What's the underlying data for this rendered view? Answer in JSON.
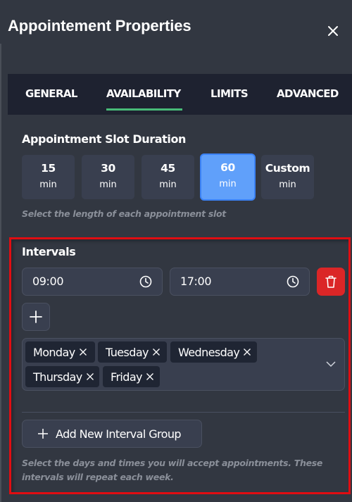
{
  "header": {
    "title": "Appointement Properties",
    "close_icon": "close-icon"
  },
  "tabs": [
    {
      "label": "GENERAL",
      "active": false
    },
    {
      "label": "AVAILABILITY",
      "active": true
    },
    {
      "label": "LIMITS",
      "active": false
    },
    {
      "label": "ADVANCED",
      "active": false
    }
  ],
  "colors": {
    "active_tab_underline": "#48bb78",
    "selected_slot": "#60a0fa",
    "delete_button": "#db2627",
    "highlight_border": "#e00d12"
  },
  "slot_duration": {
    "title": "Appointment Slot Duration",
    "options": [
      {
        "value": "15",
        "unit": "min",
        "selected": false
      },
      {
        "value": "30",
        "unit": "min",
        "selected": false
      },
      {
        "value": "45",
        "unit": "min",
        "selected": false
      },
      {
        "value": "60",
        "unit": "min",
        "selected": true
      },
      {
        "value": "Custom",
        "unit": "min",
        "selected": false
      }
    ],
    "hint": "Select the length of each appointment slot"
  },
  "intervals": {
    "title": "Intervals",
    "start_time": "09:00",
    "end_time": "17:00",
    "time_icon": "clock-icon",
    "delete_icon": "trash-icon",
    "add_time_icon": "plus-icon",
    "days": [
      "Monday",
      "Tuesday",
      "Wednesday",
      "Thursday",
      "Friday"
    ],
    "dropdown_icon": "chevron-down-icon",
    "add_group_label": "Add New Interval Group",
    "hint_line1": "Select the days and times you will accept appointments. These",
    "hint_line2": "intervals will repeat each week."
  }
}
